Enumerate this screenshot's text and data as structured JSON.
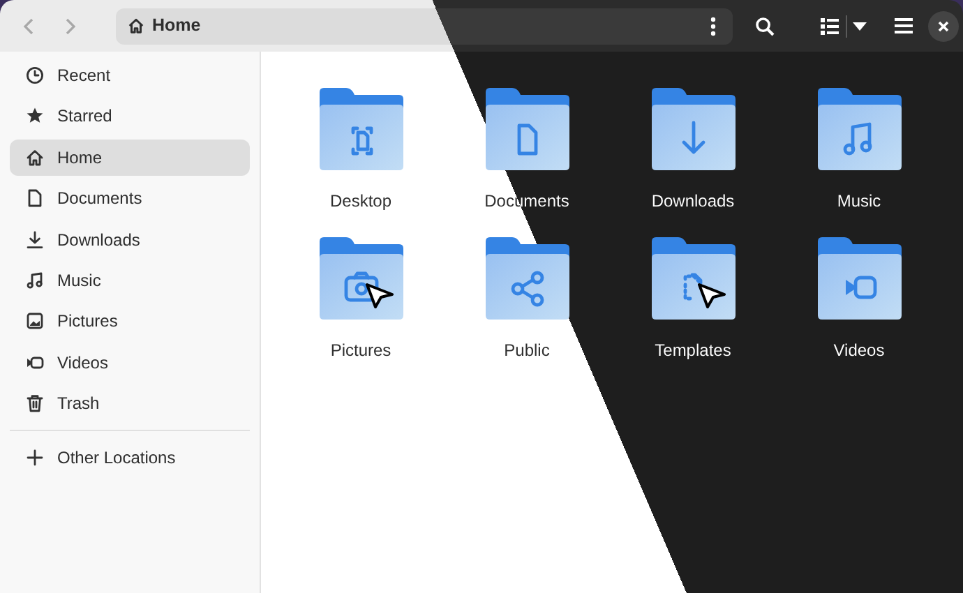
{
  "header": {
    "back": {
      "disabled": true
    },
    "forward": {
      "disabled": true
    },
    "path": {
      "label": "Home"
    }
  },
  "sidebar": {
    "items": [
      {
        "label": "Recent",
        "selected": false
      },
      {
        "label": "Starred",
        "selected": false
      },
      {
        "label": "Home",
        "selected": true
      },
      {
        "label": "Documents",
        "selected": false
      },
      {
        "label": "Downloads",
        "selected": false
      },
      {
        "label": "Music",
        "selected": false
      },
      {
        "label": "Pictures",
        "selected": false
      },
      {
        "label": "Videos",
        "selected": false
      },
      {
        "label": "Trash",
        "selected": false
      }
    ],
    "other_locations": {
      "label": "Other Locations"
    }
  },
  "folders": [
    {
      "label": "Desktop",
      "cursor": false
    },
    {
      "label": "Documents",
      "cursor": false
    },
    {
      "label": "Downloads",
      "cursor": false
    },
    {
      "label": "Music",
      "cursor": false
    },
    {
      "label": "Pictures",
      "cursor": true
    },
    {
      "label": "Public",
      "cursor": false
    },
    {
      "label": "Templates",
      "cursor": true
    },
    {
      "label": "Videos",
      "cursor": false
    }
  ]
}
